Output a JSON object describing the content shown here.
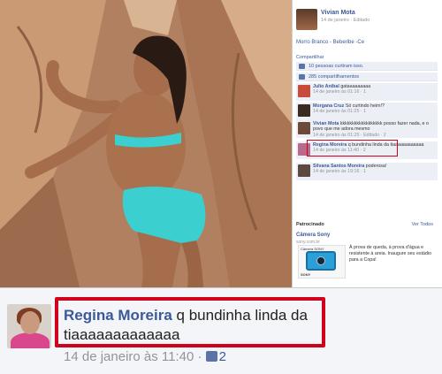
{
  "photo_post": {
    "owner_name": "Vivian Mota",
    "owner_meta": "14 de janeiro · Editado",
    "caption": "Morro Branco - Beberibe -Ce",
    "share_label": "Compartilhar",
    "likes_text": "10 pessoas curtiram isso.",
    "shares_text": "285 compartilhamentos"
  },
  "comments": [
    {
      "author": "Julio Aníbal",
      "text": "gataaaaaaaaa",
      "meta": "14 de janeiro às 01:16 · 1"
    },
    {
      "author": "Morgana Cruz",
      "text": "Só curtindo heim!?",
      "meta": "14 de janeiro às 01:25 · 1"
    },
    {
      "author": "Vivian Mota",
      "text": "kkkkkkkkkkkkkkkkkk posso fazer nada, e o povo que me adora mesmo",
      "meta": "14 de janeiro às 01:25 · Editado · 2"
    },
    {
      "author": "Regina Moreira",
      "text": "q bundinha linda da tiaaaaaaaaaaaa",
      "meta": "14 de janeiro às 11:40 · 2"
    },
    {
      "author": "Silvana Santos Moreira",
      "text": "poderosa!",
      "meta": "14 de janeiro às 19:16 · 1"
    }
  ],
  "sponsored": {
    "header": "Patrocinado",
    "see_all": "Ver Todos",
    "ad_title": "Câmera Sony",
    "ad_url": "sony.com.br",
    "ad_image_label": "Câmera SONY",
    "ad_brand": "SONY",
    "ad_body": "À prova de queda, à prova d'água e resistente à areia. Inaugure seu estádio para a Copa!"
  },
  "zoom_comment": {
    "author": "Regina Moreira",
    "text": "q bundinha linda da tiaaaaaaaaaaaaa",
    "timestamp": "14 de janeiro às 11:40 ·",
    "like_count": "2"
  },
  "colors": {
    "fb_blue": "#3b5998",
    "highlight_red": "#d0021b",
    "swimsuit": "#3ccfcf"
  }
}
